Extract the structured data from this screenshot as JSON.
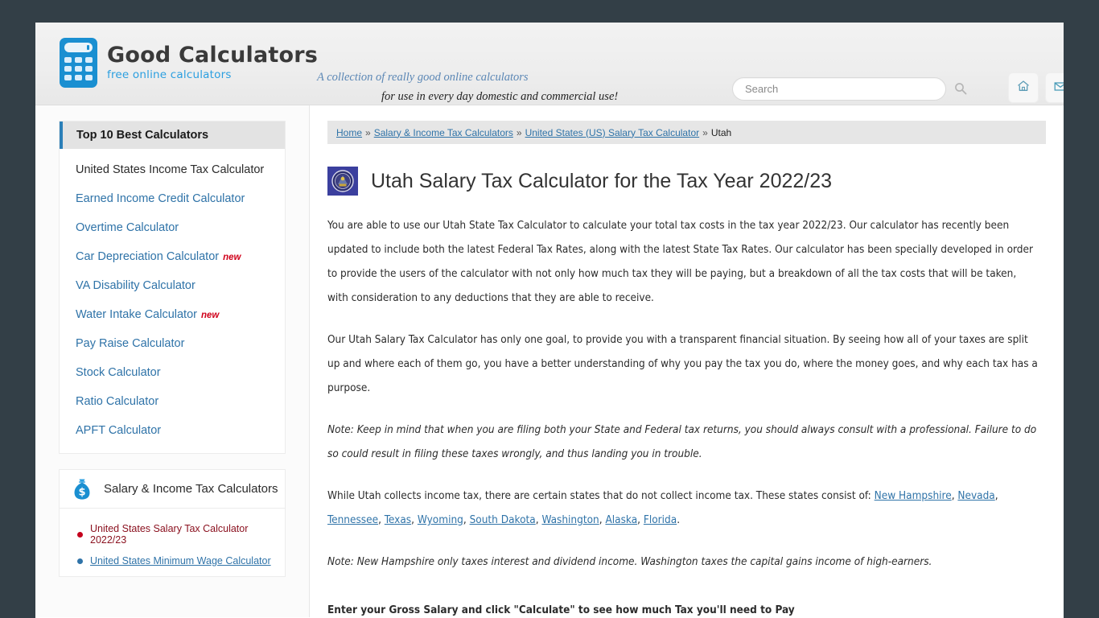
{
  "header": {
    "logo_main": "Good Calculators",
    "logo_sub": "free online calculators",
    "tagline_line1": "A collection of really good online calculators",
    "tagline_line2": "for use in every day domestic and commercial use!",
    "search_placeholder": "Search",
    "search_value": "",
    "home_button": "home-icon",
    "mail_button": "mail-icon"
  },
  "sidebar": {
    "top10": {
      "heading": "Top 10 Best Calculators",
      "items": [
        {
          "label": "United States Income Tax Calculator",
          "current": true,
          "badge": ""
        },
        {
          "label": "Earned Income Credit Calculator",
          "current": false,
          "badge": ""
        },
        {
          "label": "Overtime Calculator",
          "current": false,
          "badge": ""
        },
        {
          "label": "Car Depreciation Calculator",
          "current": false,
          "badge": "new"
        },
        {
          "label": "VA Disability Calculator",
          "current": false,
          "badge": ""
        },
        {
          "label": "Water Intake Calculator",
          "current": false,
          "badge": "new"
        },
        {
          "label": "Pay Raise Calculator",
          "current": false,
          "badge": ""
        },
        {
          "label": "Stock Calculator",
          "current": false,
          "badge": ""
        },
        {
          "label": "Ratio Calculator",
          "current": false,
          "badge": ""
        },
        {
          "label": "APFT Calculator",
          "current": false,
          "badge": ""
        }
      ]
    },
    "salary": {
      "heading": "Salary & Income Tax Calculators",
      "icon": "money-bag-icon",
      "items": [
        {
          "label": "United States Salary Tax Calculator 2022/23",
          "style": "red"
        },
        {
          "label": "United States Minimum Wage Calculator",
          "style": "blue"
        }
      ]
    }
  },
  "breadcrumb": {
    "items": [
      {
        "label": "Home",
        "link": true
      },
      {
        "label": "Salary & Income Tax Calculators",
        "link": true
      },
      {
        "label": "United States (US) Salary Tax Calculator",
        "link": true
      },
      {
        "label": "Utah",
        "link": false
      }
    ],
    "separator": "»"
  },
  "main": {
    "title": "Utah Salary Tax Calculator for the Tax Year 2022/23",
    "seal_icon": "utah-state-seal-icon",
    "paragraph1": "You are able to use our Utah State Tax Calculator to calculate your total tax costs in the tax year 2022/23. Our calculator has recently been updated to include both the latest Federal Tax Rates, along with the latest State Tax Rates. Our calculator has been specially developed in order to provide the users of the calculator with not only how much tax they will be paying, but a breakdown of all the tax costs that will be taken, with consideration to any deductions that they are able to receive.",
    "paragraph2": "Our Utah Salary Tax Calculator has only one goal, to provide you with a transparent financial situation. By seeing how all of your taxes are split up and where each of them go, you have a better understanding of why you pay the tax you do, where the money goes, and why each tax has a purpose.",
    "note1": "Note: Keep in mind that when you are filing both your State and Federal tax returns, you should always consult with a professional. Failure to do so could result in filing these taxes wrongly, and thus landing you in trouble.",
    "states_intro": "While Utah collects income tax, there are certain states that do not collect income tax. These states consist of: ",
    "states": [
      "New Hampshire",
      "Nevada",
      "Tennessee",
      "Texas",
      "Wyoming",
      "South Dakota",
      "Washington",
      "Alaska",
      "Florida"
    ],
    "note2": "Note: New Hampshire only taxes interest and dividend income. Washington taxes the capital gains income of high-earners.",
    "cta": "Enter your Gross Salary and click \"Calculate\" to see how much Tax you'll need to Pay"
  },
  "colors": {
    "page_background": "#333f47",
    "accent_blue": "#2b7fb8",
    "link_blue": "#2f73a8",
    "logo_blue": "#1a8fd1",
    "badge_red": "#d0021b"
  }
}
